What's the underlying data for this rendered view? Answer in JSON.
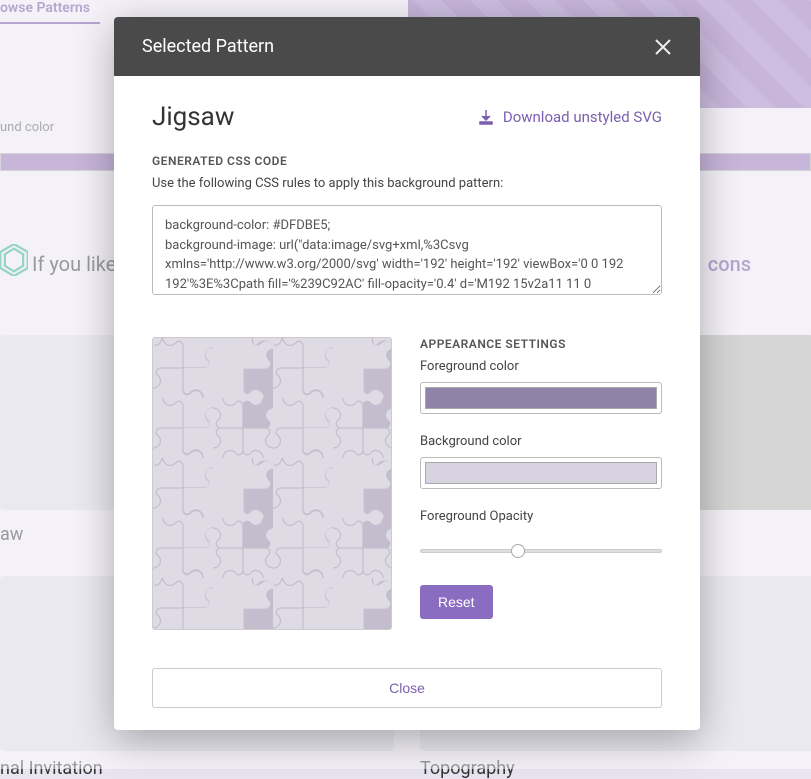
{
  "bg": {
    "browse_label": "owse Patterns",
    "color_label": "und color",
    "if_you_like": "If you like",
    "icons_link": "cons",
    "tile1_label": "aw",
    "tile3_label": "nal Invitation",
    "tile4_label": "Topography"
  },
  "modal": {
    "header_title": "Selected Pattern",
    "pattern_name": "Jigsaw",
    "download_label": "Download unstyled SVG",
    "generated_label": "GENERATED CSS CODE",
    "hint": "Use the following CSS rules to apply this background pattern:",
    "css_code": "background-color: #DFDBE5;\nbackground-image: url(\"data:image/svg+xml,%3Csvg xmlns='http://www.w3.org/2000/svg' width='192' height='192' viewBox='0 0 192 192'%3E%3Cpath fill='%239C92AC' fill-opacity='0.4' d='M192 15v2a11 11 0",
    "appearance_label": "APPEARANCE SETTINGS",
    "fg_label": "Foreground color",
    "bg_label": "Background color",
    "opacity_label": "Foreground Opacity",
    "opacity_value": "40",
    "reset_label": "Reset",
    "close_label": "Close",
    "fg_color": "#9C92AC",
    "bg_color": "#DFDBE5"
  }
}
